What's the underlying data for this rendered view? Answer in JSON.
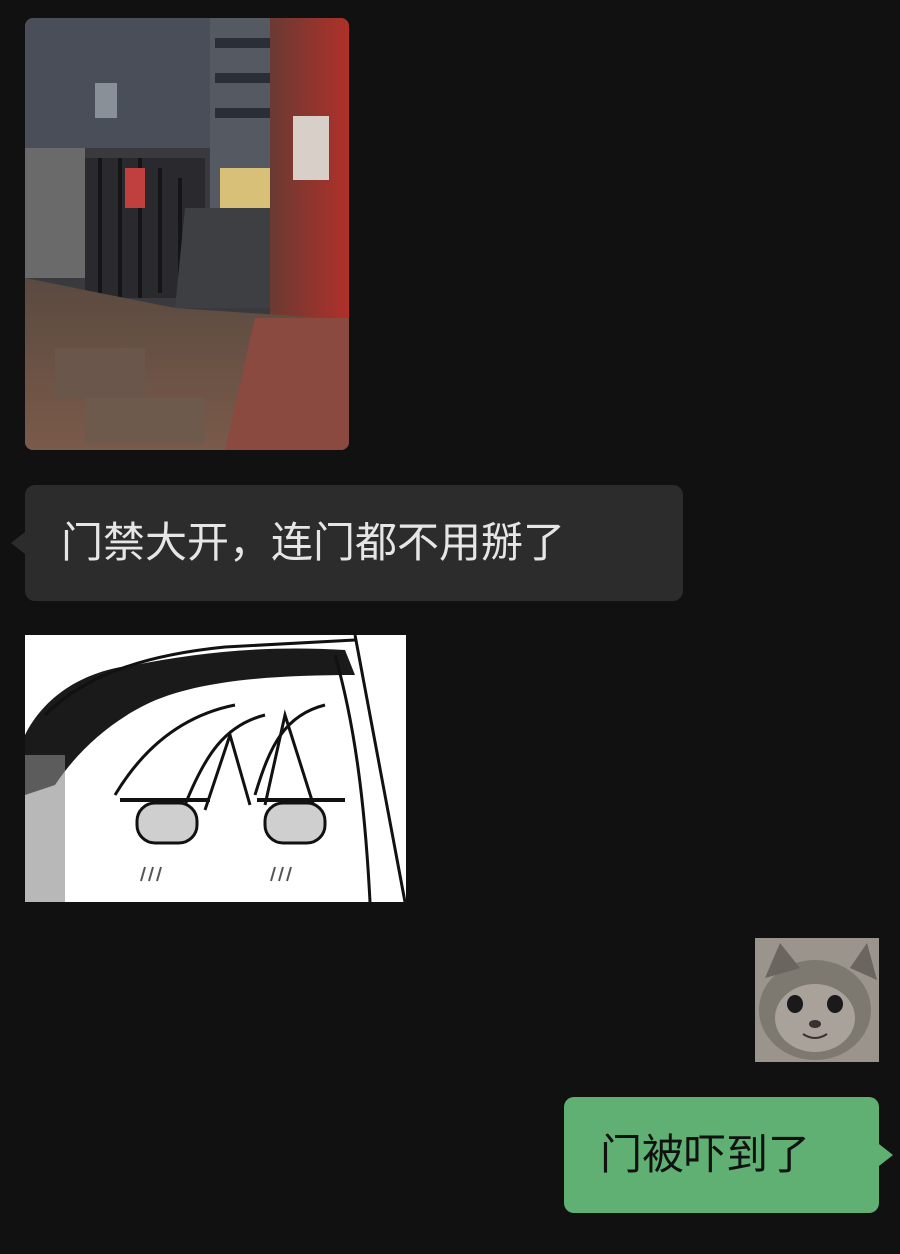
{
  "messages": [
    {
      "side": "left",
      "kind": "image",
      "icon": "night-gate-photo"
    },
    {
      "side": "left",
      "kind": "text",
      "text": "门禁大开，连门都不用掰了"
    },
    {
      "side": "left",
      "kind": "sticker",
      "icon": "manga-face-sticker"
    },
    {
      "side": "right",
      "kind": "sticker",
      "icon": "cat-face-sticker"
    },
    {
      "side": "right",
      "kind": "text",
      "text": "门被吓到了"
    }
  ],
  "colors": {
    "background": "#111111",
    "incoming_bubble": "#2c2c2c",
    "incoming_text": "#e6e6e6",
    "outgoing_bubble": "#5fb072",
    "outgoing_text": "#111111"
  }
}
